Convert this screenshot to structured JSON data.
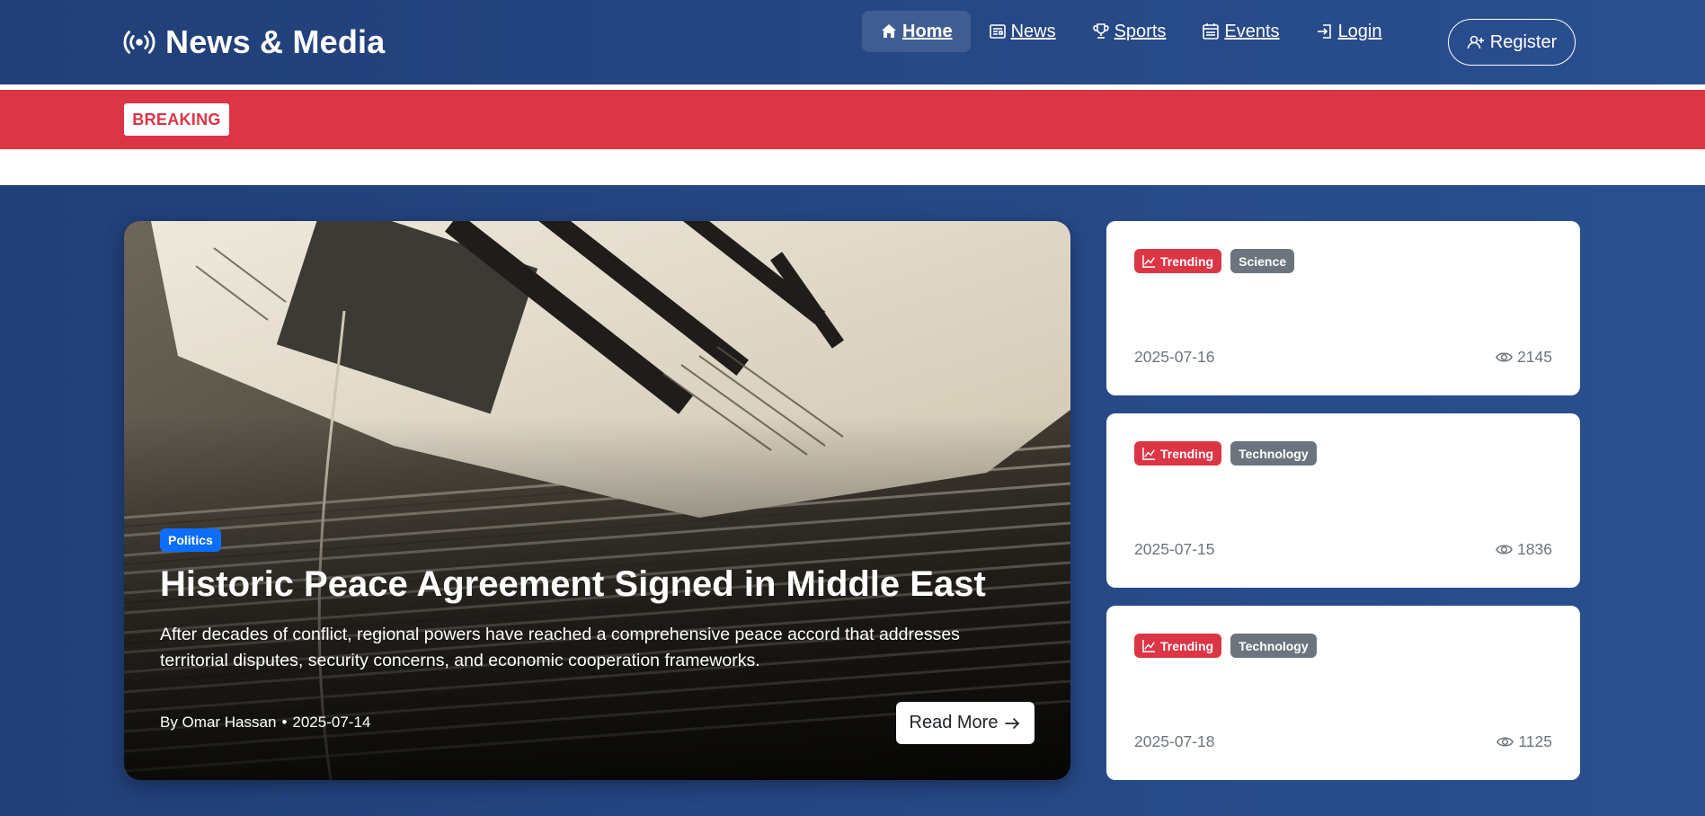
{
  "brand": {
    "name": "News & Media",
    "icon": "broadcast-icon"
  },
  "nav": {
    "items": [
      {
        "label": "Home",
        "icon": "house-icon",
        "active": true
      },
      {
        "label": "News",
        "icon": "newspaper-icon"
      },
      {
        "label": "Sports",
        "icon": "trophy-icon"
      },
      {
        "label": "Events",
        "icon": "calendar-icon"
      },
      {
        "label": "Login",
        "icon": "login-icon"
      }
    ],
    "register_label": "Register",
    "register_icon": "person-plus-icon"
  },
  "breaking": {
    "label": "BREAKING"
  },
  "hero": {
    "category": "Politics",
    "title": "Historic Peace Agreement Signed in Middle East",
    "excerpt": "After decades of conflict, regional powers have reached a comprehensive peace accord that addresses territorial disputes, security concerns, and economic cooperation frameworks.",
    "author": "By Omar Hassan",
    "separator": "•",
    "date": "2025-07-14",
    "read_more": "Read More",
    "image": "stacked-newspapers-photo"
  },
  "side_cards": [
    {
      "trend_label": "Trending",
      "category": "Science",
      "date": "2025-07-16",
      "views": "2145"
    },
    {
      "trend_label": "Trending",
      "category": "Technology",
      "date": "2025-07-15",
      "views": "1836"
    },
    {
      "trend_label": "Trending",
      "category": "Technology",
      "date": "2025-07-18",
      "views": "1125"
    }
  ],
  "colors": {
    "navy": "#213f78",
    "breaking_red": "#dc3545",
    "primary_blue": "#0d6efd",
    "secondary_gray": "#6c757d"
  }
}
